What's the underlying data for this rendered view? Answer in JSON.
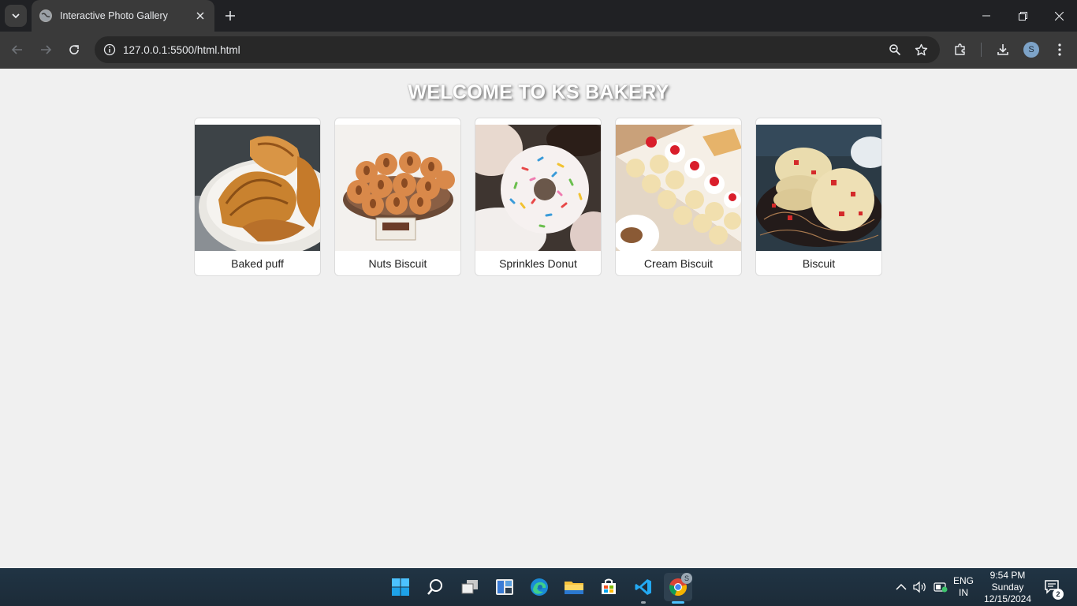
{
  "browser": {
    "tab_title": "Interactive Photo Gallery",
    "url_host": "127.0.0.1",
    "url_path": ":5500/html.html",
    "profile_initial": "S"
  },
  "page": {
    "heading": "WELCOME TO KS BAKERY",
    "gallery": [
      {
        "caption": "Baked puff",
        "image": "croissants-photo"
      },
      {
        "caption": "Nuts Biscuit",
        "image": "almond-cookies-photo"
      },
      {
        "caption": "Sprinkles Donut",
        "image": "sprinkles-donut-photo"
      },
      {
        "caption": "Cream Biscuit",
        "image": "cream-biscuits-photo"
      },
      {
        "caption": "Biscuit",
        "image": "cherry-biscuits-photo"
      }
    ]
  },
  "taskbar": {
    "lang_line1": "ENG",
    "lang_line2": "IN",
    "time": "9:54 PM",
    "day": "Sunday",
    "date": "12/15/2024",
    "notification_count": "2",
    "chrome_badge": "S"
  },
  "colors": {
    "page_bg": "#f0f0f0",
    "chrome_dark": "#202124",
    "toolbar": "#3a3a3a",
    "taskbar": "#1f2d3a"
  }
}
